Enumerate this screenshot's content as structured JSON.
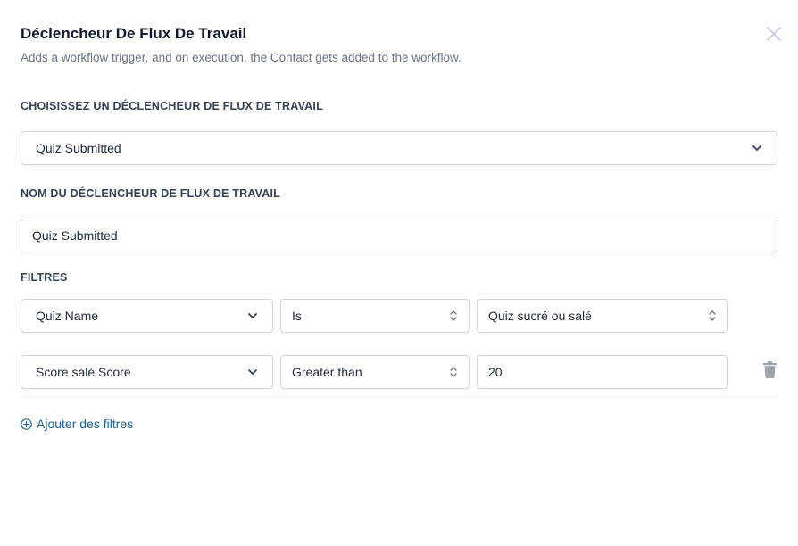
{
  "header": {
    "title": "Déclencheur De Flux De Travail",
    "subtitle": "Adds a workflow trigger, and on execution, the Contact gets added to the workflow."
  },
  "trigger_section": {
    "label": "CHOISISSEZ UN DÉCLENCHEUR DE FLUX DE TRAVAIL",
    "selected": "Quiz Submitted"
  },
  "name_section": {
    "label": "NOM DU DÉCLENCHEUR DE FLUX DE TRAVAIL",
    "value": "Quiz Submitted"
  },
  "filters": {
    "label": "FILTRES",
    "rows": [
      {
        "field": "Quiz Name",
        "operator": "Is",
        "value": "Quiz sucré ou salé"
      },
      {
        "field": "Score salé Score",
        "operator": "Greater than",
        "value": "20"
      }
    ],
    "add_label": "Ajouter des filtres"
  },
  "colors": {
    "link": "#1f5f8b",
    "border": "#d1d5db",
    "icon_gray": "#6b7280"
  }
}
